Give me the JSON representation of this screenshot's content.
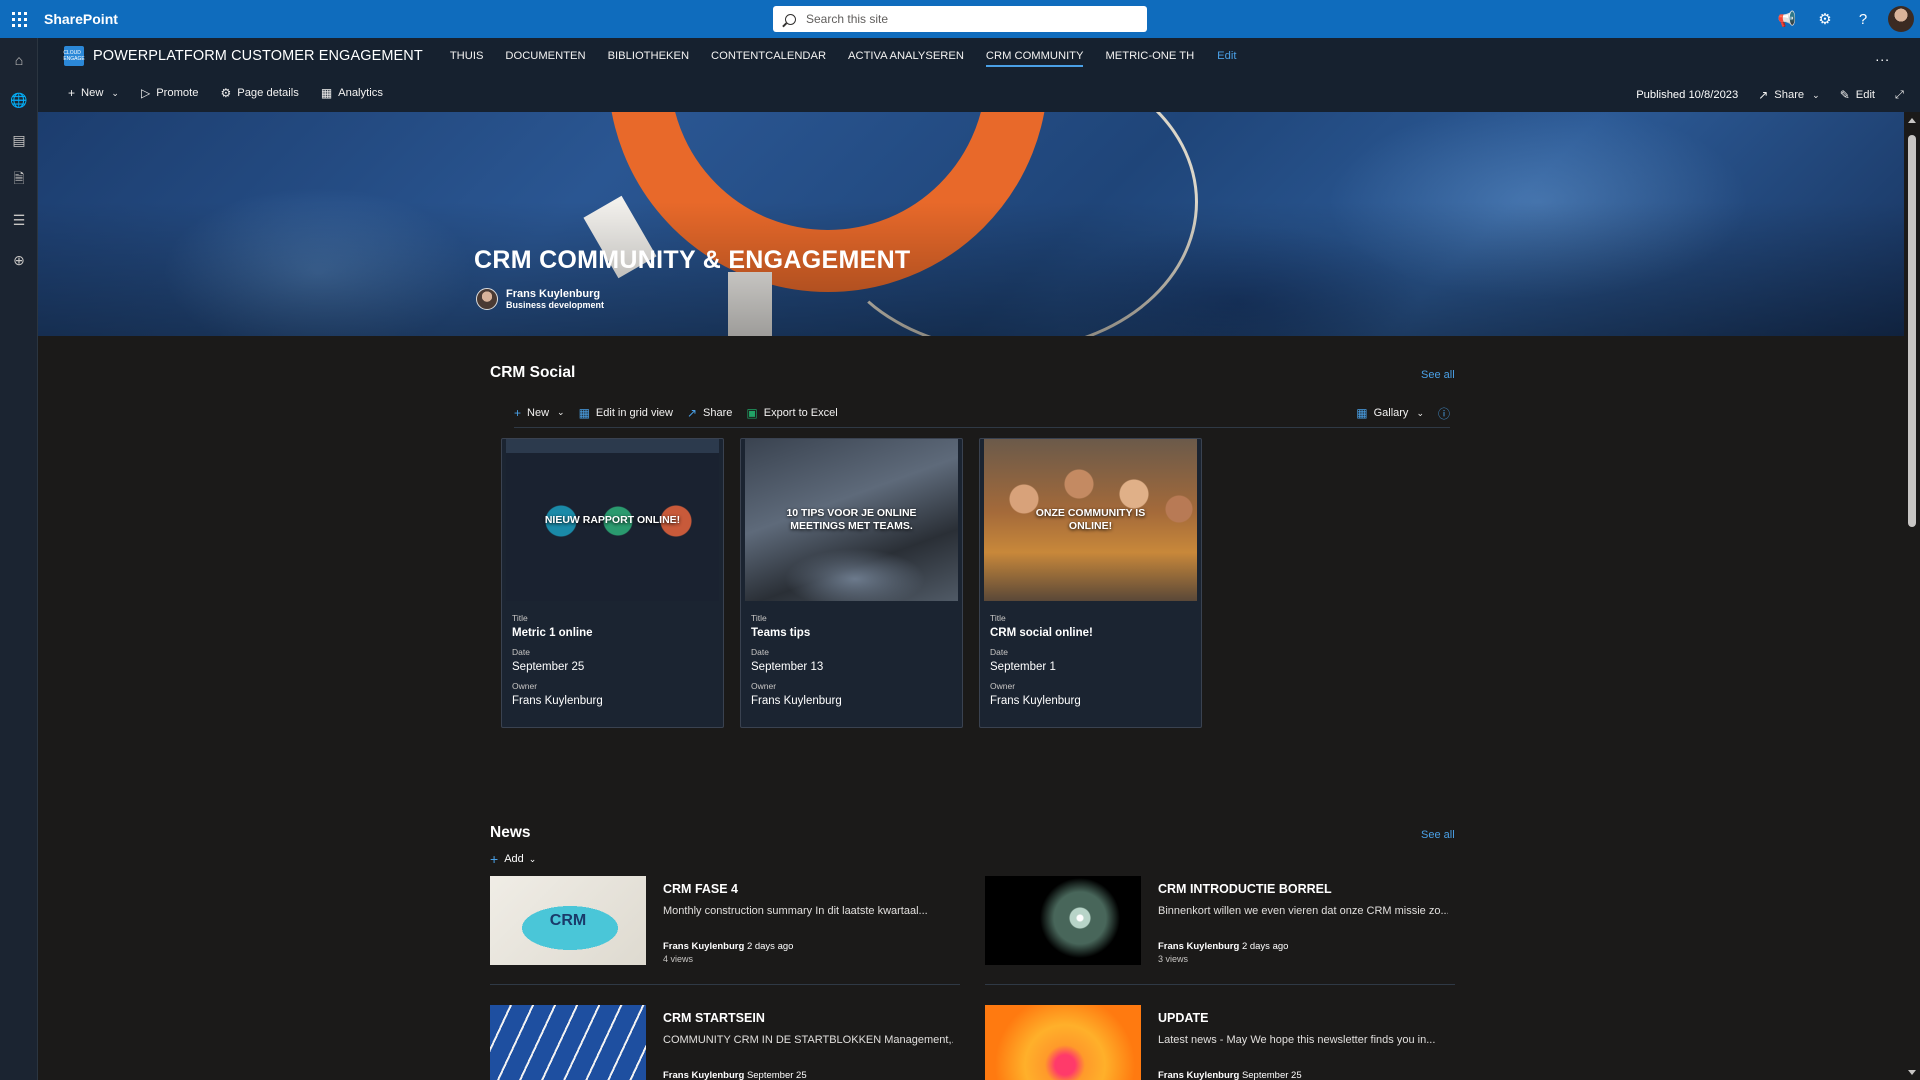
{
  "suite": {
    "app_name": "SharePoint",
    "search_placeholder": "Search this site"
  },
  "site": {
    "title": "POWERPLATFORM CUSTOMER ENGAGEMENT",
    "logo_text": "CLOUD ENGAGE",
    "nav": [
      {
        "label": "THUIS",
        "active": false
      },
      {
        "label": "DOCUMENTEN",
        "active": false
      },
      {
        "label": "BIBLIOTHEKEN",
        "active": false
      },
      {
        "label": "CONTENTCALENDAR",
        "active": false
      },
      {
        "label": "ACTIVA ANALYSEREN",
        "active": false
      },
      {
        "label": "CRM COMMUNITY",
        "active": true
      },
      {
        "label": "METRIC-ONE TH",
        "active": false
      }
    ],
    "nav_edit": "Edit",
    "more": "..."
  },
  "commandbar": {
    "new": "New",
    "promote": "Promote",
    "page_details": "Page details",
    "analytics": "Analytics",
    "published": "Published 10/8/2023",
    "share": "Share",
    "edit": "Edit"
  },
  "hero": {
    "title": "CRM COMMUNITY & ENGAGEMENT",
    "author_name": "Frans Kuylenburg",
    "author_role": "Business development"
  },
  "crm_social": {
    "title": "CRM Social",
    "see_all": "See all",
    "toolbar": {
      "new": "New",
      "edit_grid": "Edit in grid view",
      "share": "Share",
      "export": "Export to Excel",
      "view": "Gallary"
    },
    "cards": [
      {
        "image_text": "NIEUW RAPPORT ONLINE!",
        "title_label": "Title",
        "title": "Metric 1 online",
        "date_label": "Date",
        "date": "September 25",
        "owner_label": "Owner",
        "owner": "Frans Kuylenburg"
      },
      {
        "image_text": "10 TIPS VOOR JE ONLINE MEETINGS MET TEAMS.",
        "title_label": "Title",
        "title": "Teams tips",
        "date_label": "Date",
        "date": "September 13",
        "owner_label": "Owner",
        "owner": "Frans Kuylenburg"
      },
      {
        "image_text": "ONZE COMMUNITY IS ONLINE!",
        "title_label": "Title",
        "title": "CRM social online!",
        "date_label": "Date",
        "date": "September 1",
        "owner_label": "Owner",
        "owner": "Frans Kuylenburg"
      }
    ]
  },
  "news": {
    "title": "News",
    "see_all": "See all",
    "add": "Add",
    "items": [
      {
        "title": "CRM FASE 4",
        "desc": "Monthly construction summary In dit laatste kwartaal...",
        "author": "Frans Kuylenburg",
        "when": "2 days ago",
        "views": "4 views",
        "thumb_text": "CRM"
      },
      {
        "title": "CRM INTRODUCTIE BORREL",
        "desc": "Binnenkort willen we even vieren dat onze CRM missie zo...",
        "author": "Frans Kuylenburg",
        "when": "2 days ago",
        "views": "3 views"
      },
      {
        "title": "CRM STARTSEIN",
        "desc": "COMMUNITY CRM IN DE STARTBLOKKEN Management,...",
        "author": "Frans Kuylenburg",
        "when": "September 25"
      },
      {
        "title": "UPDATE",
        "desc": "Latest news - May We hope this newsletter finds you in...",
        "author": "Frans Kuylenburg",
        "when": "September 25"
      }
    ]
  },
  "colors": {
    "suite_bar": "#0f6cbd",
    "accent": "#4aa0e6",
    "background": "#1b1a19",
    "header": "#16212f"
  }
}
